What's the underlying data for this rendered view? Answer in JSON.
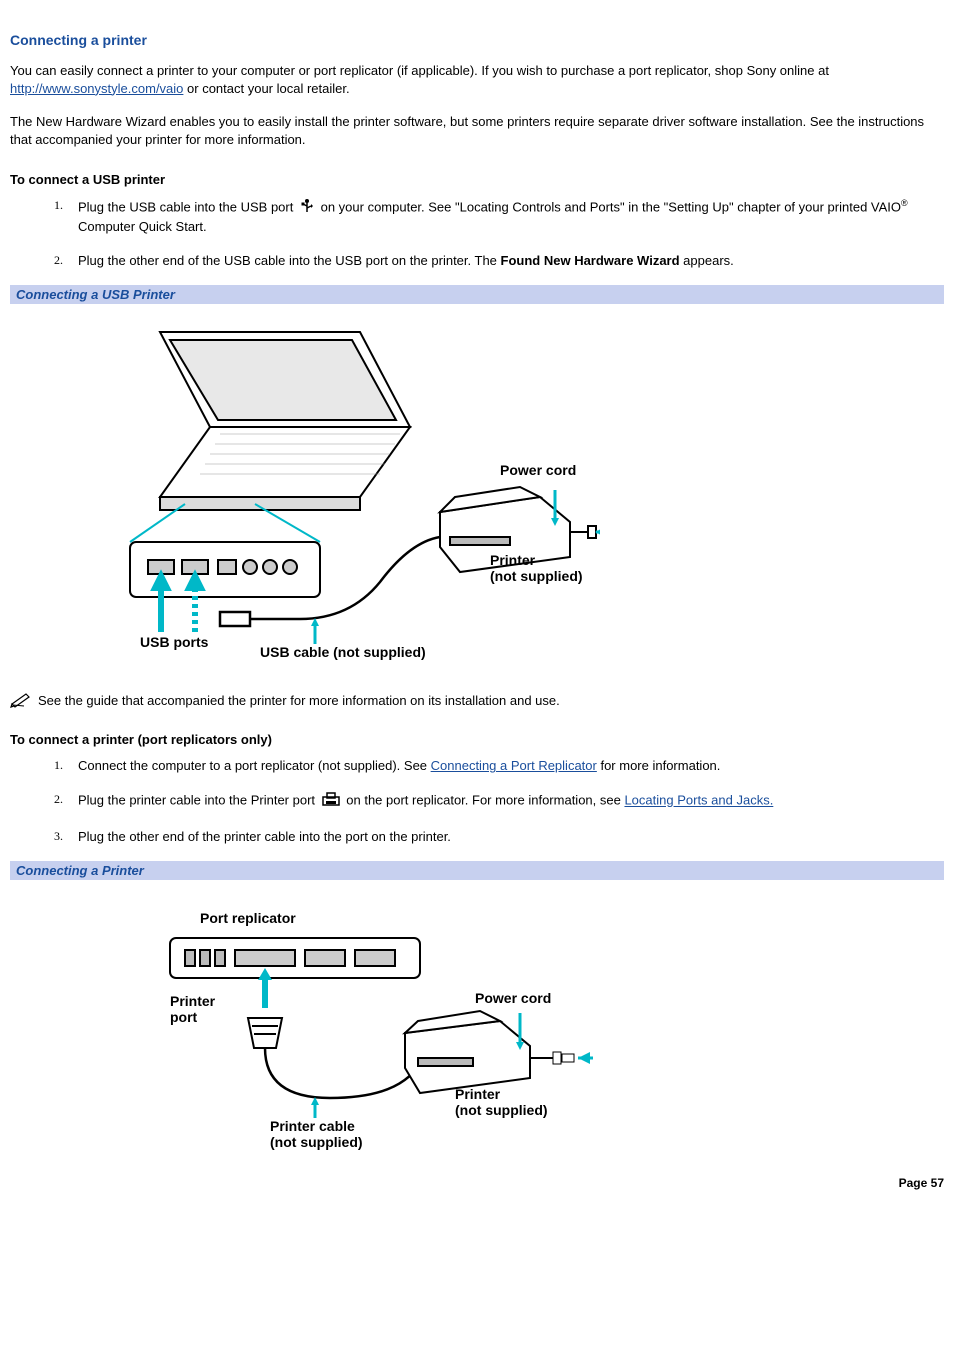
{
  "title": "Connecting a printer",
  "intro1_a": "You can easily connect a printer to your computer or port replicator (if applicable). If you wish to purchase a port replicator, shop Sony online at ",
  "intro1_link": "http://www.sonystyle.com/vaio",
  "intro1_b": " or contact your local retailer.",
  "intro2": "The New Hardware Wizard enables you to easily install the printer software, but some printers require separate driver software installation. See the instructions that accompanied your printer for more information.",
  "subhead_usb": "To connect a USB printer",
  "usb_steps": {
    "s1a": "Plug the USB cable into the USB port ",
    "s1b": " on your computer. See \"Locating Controls and Ports\" in the \"Setting Up\" chapter of your printed VAIO",
    "s1c": " Computer Quick Start.",
    "s2a": "Plug the other end of the USB cable into the USB port on the printer. The ",
    "s2b": "Found New Hardware Wizard",
    "s2c": " appears."
  },
  "caption_usb": "Connecting a USB Printer",
  "fig1_labels": {
    "power_cord": "Power cord",
    "printer": "Printer",
    "not_supplied": "(not supplied)",
    "usb_ports": "USB ports",
    "usb_cable": "USB cable (not supplied)"
  },
  "note_text": "See the guide that accompanied the printer for more information on its installation and use.",
  "subhead_port": "To connect a printer (port replicators only)",
  "port_steps": {
    "s1a": "Connect the computer to a port replicator (not supplied). See ",
    "s1b": "Connecting a Port Replicator",
    "s1c": " for more information.",
    "s2a": "Plug the printer cable into the Printer port ",
    "s2b": " on the port replicator. For more information, see ",
    "s2c": "Locating Ports and Jacks.",
    "s3": "Plug the other end of the printer cable into the port on the printer."
  },
  "caption_printer": "Connecting a Printer",
  "fig2_labels": {
    "port_replicator": "Port replicator",
    "printer_port": "Printer",
    "printer_port2": "port",
    "power_cord": "Power cord",
    "printer": "Printer",
    "not_supplied": "(not supplied)",
    "printer_cable": "Printer cable",
    "cable_not_supplied": "(not supplied)"
  },
  "page": "Page 57",
  "nums": {
    "n1": "1.",
    "n2": "2.",
    "n3": "3."
  },
  "reg": "®"
}
